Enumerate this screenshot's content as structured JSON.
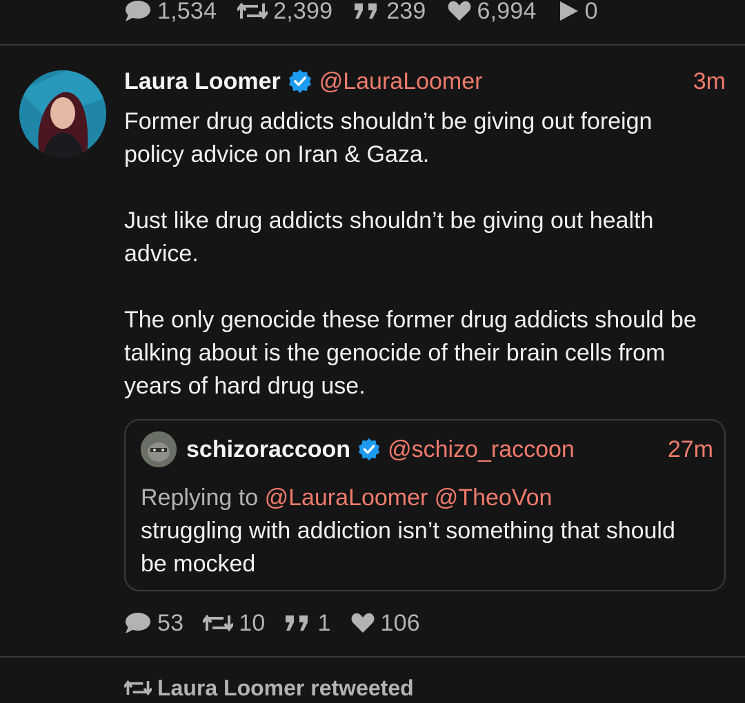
{
  "previous_tweet": {
    "stats": {
      "replies": "1,534",
      "retweets": "2,399",
      "quotes": "239",
      "likes": "6,994",
      "views": "0"
    }
  },
  "tweet": {
    "name": "Laura Loomer",
    "handle": "@LauraLoomer",
    "time": "3m",
    "paragraphs": [
      "Former drug addicts shouldn’t be giving out foreign policy advice on Iran & Gaza.",
      "Just like drug addicts shouldn’t be giving out health advice.",
      "The only genocide these former drug addicts should be talking about is the genocide of their brain cells from years of hard drug use."
    ],
    "quote": {
      "name": "schizoraccoon",
      "handle": "@schizo_raccoon",
      "time": "27m",
      "replying_prefix": "Replying to",
      "replying_mentions": [
        "@LauraLoomer",
        "@TheoVon"
      ],
      "text": "struggling with addiction isn’t something that should be mocked"
    },
    "stats": {
      "replies": "53",
      "retweets": "10",
      "quotes": "1",
      "likes": "106"
    }
  },
  "next_item": {
    "retweeted_label": "Laura Loomer retweeted"
  },
  "colors": {
    "background": "#151515",
    "accent": "#f07b6c",
    "verified": "#1d9bf0",
    "muted": "#b3b3b3"
  },
  "icons": [
    "reply-icon",
    "retweet-icon",
    "quote-icon",
    "like-icon",
    "views-icon",
    "verified-badge-icon"
  ]
}
